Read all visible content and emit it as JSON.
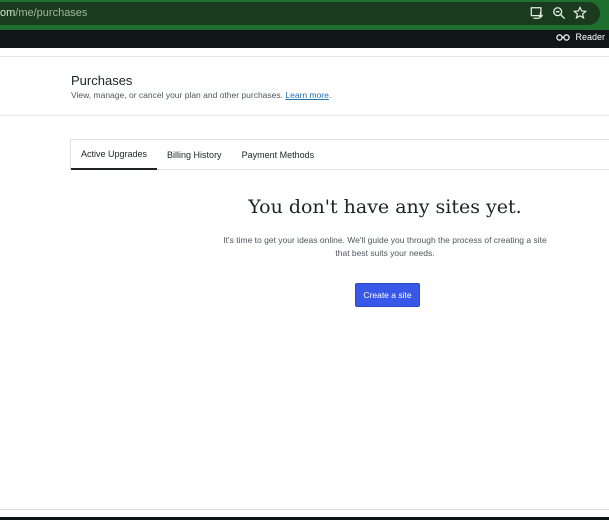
{
  "browser": {
    "url_prefix": "om",
    "url_path": "/me/purchases",
    "icons": [
      "install-app-icon",
      "zoom-icon",
      "bookmark-star-icon"
    ]
  },
  "masterbar": {
    "reader_label": "Reader",
    "reader_icon": "reader-glasses-icon"
  },
  "header": {
    "title": "Purchases",
    "subtitle": "View, manage, or cancel your plan and other purchases.",
    "learn_more": "Learn more",
    "period": "."
  },
  "tabs": [
    {
      "label": "Active Upgrades",
      "active": true
    },
    {
      "label": "Billing History",
      "active": false
    },
    {
      "label": "Payment Methods",
      "active": false
    }
  ],
  "empty_state": {
    "title": "You don't have any sites yet.",
    "line1": "It's time to get your ideas online. We'll guide you through the process of creating a site",
    "line2": "that best suits your needs.",
    "button": "Create a site"
  },
  "colors": {
    "browser_bar": "#1f6f2f",
    "masterbar": "#101517",
    "primary_button": "#3858e9",
    "link": "#2271b1"
  }
}
